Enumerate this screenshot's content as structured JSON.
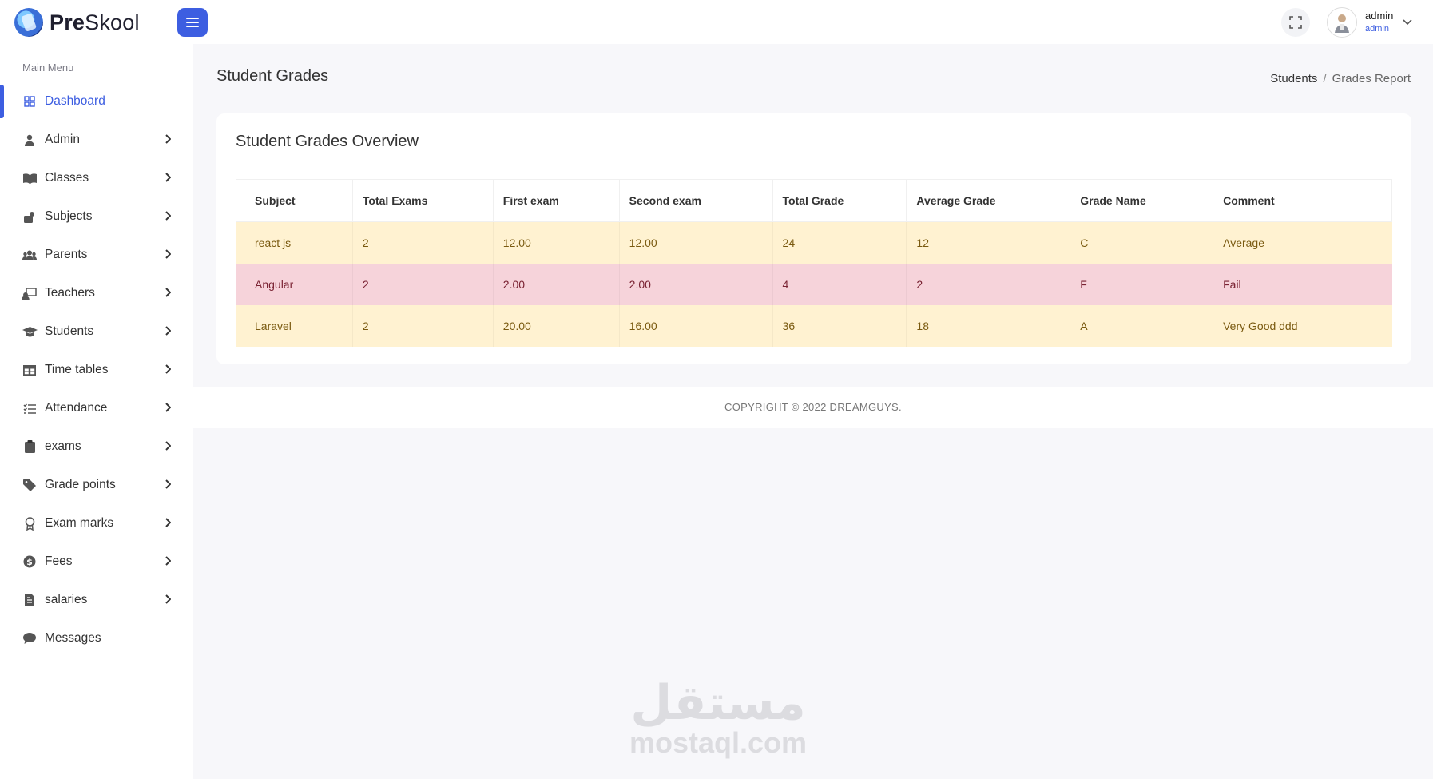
{
  "app": {
    "logo_text_bold": "Pre",
    "logo_text_rest": "Skool",
    "accent_color": "#3d5ee1"
  },
  "header": {
    "menu_toggle_icon": "hamburger-icon",
    "fullscreen_icon": "fullscreen-icon",
    "user": {
      "name": "admin",
      "role": "admin",
      "chevron_icon": "chevron-down-icon"
    }
  },
  "sidebar": {
    "title": "Main Menu",
    "items": [
      {
        "label": "Dashboard",
        "icon": "dashboard-grid-icon",
        "active": true,
        "has_children": false
      },
      {
        "label": "Admin",
        "icon": "user-icon",
        "has_children": true
      },
      {
        "label": "Classes",
        "icon": "book-open-icon",
        "has_children": true
      },
      {
        "label": "Subjects",
        "icon": "briefcase-icon",
        "has_children": true
      },
      {
        "label": "Parents",
        "icon": "users-icon",
        "has_children": true
      },
      {
        "label": "Teachers",
        "icon": "chalkboard-teacher-icon",
        "has_children": true
      },
      {
        "label": "Students",
        "icon": "graduation-cap-icon",
        "has_children": true
      },
      {
        "label": "Time tables",
        "icon": "table-icon",
        "has_children": true
      },
      {
        "label": "Attendance",
        "icon": "list-check-icon",
        "has_children": true
      },
      {
        "label": "exams",
        "icon": "clipboard-icon",
        "has_children": true
      },
      {
        "label": "Grade points",
        "icon": "tag-icon",
        "has_children": true
      },
      {
        "label": "Exam marks",
        "icon": "award-icon",
        "has_children": true
      },
      {
        "label": "Fees",
        "icon": "money-icon",
        "has_children": true
      },
      {
        "label": "salaries",
        "icon": "file-invoice-icon",
        "has_children": true
      },
      {
        "label": "Messages",
        "icon": "comment-icon",
        "has_children": false
      }
    ]
  },
  "page": {
    "title": "Student Grades",
    "breadcrumb": {
      "parent": "Students",
      "separator": "/",
      "current": "Grades Report"
    }
  },
  "card": {
    "title": "Student Grades Overview",
    "table": {
      "columns": [
        "Subject",
        "Total Exams",
        "First exam",
        "Second exam",
        "Total Grade",
        "Average Grade",
        "Grade Name",
        "Comment"
      ],
      "rows": [
        {
          "status": "warn",
          "cells": [
            "react js",
            "2",
            "12.00",
            "12.00",
            "24",
            "12",
            "C",
            "Average"
          ]
        },
        {
          "status": "danger",
          "cells": [
            "Angular",
            "2",
            "2.00",
            "2.00",
            "4",
            "2",
            "F",
            "Fail"
          ]
        },
        {
          "status": "warn",
          "cells": [
            "Laravel",
            "2",
            "20.00",
            "16.00",
            "36",
            "18",
            "A",
            "Very Good ddd"
          ]
        }
      ],
      "row_colors": {
        "warn": "#fff2d1",
        "danger": "#f6d3da"
      }
    }
  },
  "footer": {
    "text": "COPYRIGHT © 2022 DREAMGUYS."
  },
  "watermark": {
    "arabic": "مستقل",
    "latin": "mostaql.com"
  }
}
